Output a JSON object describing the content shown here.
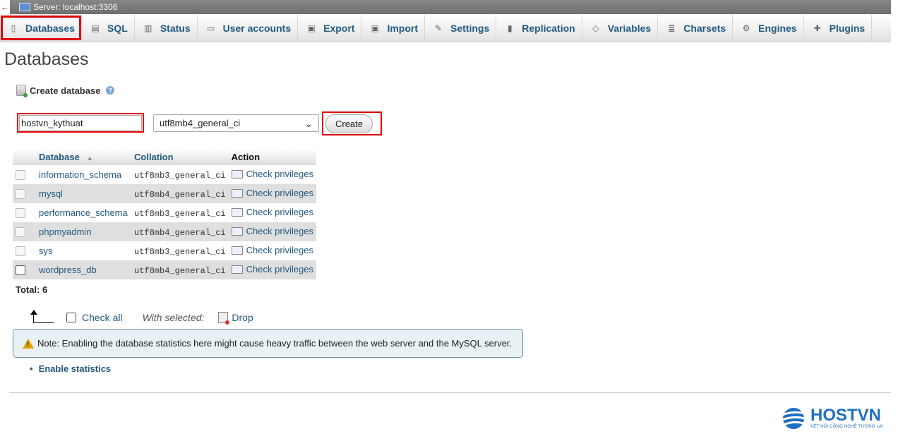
{
  "server": {
    "back_glyph": "←",
    "title": "Server: localhost:3306"
  },
  "tabs": [
    {
      "label": "Databases",
      "icon": "database-icon",
      "glyph": "▯"
    },
    {
      "label": "SQL",
      "icon": "sql-icon",
      "glyph": "▤"
    },
    {
      "label": "Status",
      "icon": "status-icon",
      "glyph": "▥"
    },
    {
      "label": "User accounts",
      "icon": "users-icon",
      "glyph": "▭"
    },
    {
      "label": "Export",
      "icon": "export-icon",
      "glyph": "▣"
    },
    {
      "label": "Import",
      "icon": "import-icon",
      "glyph": "▣"
    },
    {
      "label": "Settings",
      "icon": "wrench-icon",
      "glyph": "✎"
    },
    {
      "label": "Replication",
      "icon": "replication-icon",
      "glyph": "▮"
    },
    {
      "label": "Variables",
      "icon": "variables-icon",
      "glyph": "◇"
    },
    {
      "label": "Charsets",
      "icon": "charsets-icon",
      "glyph": "≣"
    },
    {
      "label": "Engines",
      "icon": "engines-icon",
      "glyph": "⚙"
    },
    {
      "label": "Plugins",
      "icon": "plugin-icon",
      "glyph": "✚"
    }
  ],
  "page_title": "Databases",
  "create": {
    "heading": "Create database",
    "help_glyph": "?",
    "db_name_value": "hostvn_kythuat",
    "collation_value": "utf8mb4_general_ci",
    "dropdown_glyph": "⌄",
    "button_label": "Create"
  },
  "table": {
    "headers": {
      "database": "Database",
      "sort_glyph": "▲",
      "collation": "Collation",
      "action": "Action"
    },
    "rows": [
      {
        "name": "information_schema",
        "collation": "utf8mb3_general_ci",
        "action": "Check privileges"
      },
      {
        "name": "mysql",
        "collation": "utf8mb4_general_ci",
        "action": "Check privileges"
      },
      {
        "name": "performance_schema",
        "collation": "utf8mb3_general_ci",
        "action": "Check privileges"
      },
      {
        "name": "phpmyadmin",
        "collation": "utf8mb4_general_ci",
        "action": "Check privileges"
      },
      {
        "name": "sys",
        "collation": "utf8mb3_general_ci",
        "action": "Check privileges"
      },
      {
        "name": "wordpress_db",
        "collation": "utf8mb4_general_ci",
        "action": "Check privileges"
      }
    ]
  },
  "total": "Total: 6",
  "bulk": {
    "check_all": "Check all",
    "with_selected": "With selected:",
    "drop": "Drop"
  },
  "note": {
    "text": "Note: Enabling the database statistics here might cause heavy traffic between the web server and the MySQL server.",
    "glyph": "!"
  },
  "enable_statistics": "Enable statistics",
  "logo": {
    "brand": "HOSTVN",
    "tagline": "KẾT NỐI CÔNG NGHỆ TƯƠNG LAI"
  },
  "colors": {
    "accent": "#235a81",
    "highlight": "#e00000",
    "brand": "#1f6fc2"
  }
}
